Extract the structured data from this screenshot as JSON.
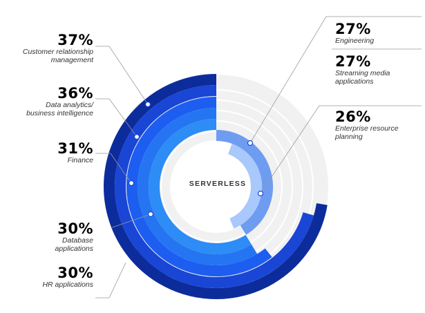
{
  "chart_data": {
    "type": "radial_bar",
    "center_label": "SERVERLESS",
    "series": [
      {
        "value": 37,
        "value_label": "37%",
        "label": "Customer relationship management",
        "lines": [
          "Customer relationship",
          "management"
        ],
        "color": "#0d2c9c",
        "text_color": "#0f3aa6",
        "side": "left"
      },
      {
        "value": 36,
        "value_label": "36%",
        "label": "Data analytics/ business intelligence",
        "lines": [
          "Data analytics/",
          "business intelligence"
        ],
        "color": "#1a46d6",
        "text_color": "#1a46d6",
        "side": "left"
      },
      {
        "value": 31,
        "value_label": "31%",
        "label": "Finance",
        "lines": [
          "Finance"
        ],
        "color": "#1d5ef0",
        "text_color": "#1d5ef0",
        "side": "left"
      },
      {
        "value": 30,
        "value_label": "30%",
        "label": "Database applications",
        "lines": [
          "Database",
          "applications"
        ],
        "color": "#2575f2",
        "text_color": "#5f7dd6",
        "side": "left"
      },
      {
        "value": 30,
        "value_label": "30%",
        "label": "HR applications",
        "lines": [
          "HR applications"
        ],
        "color": "#2d8cf5",
        "text_color": "#5f7dd6",
        "side": "left"
      },
      {
        "value": 27,
        "value_label": "27%",
        "label": "Engineering",
        "lines": [
          "Engineering"
        ],
        "color": "#6e9cf0",
        "text_color": "#5e8ef0",
        "side": "right"
      },
      {
        "value": 27,
        "value_label": "27%",
        "label": "Streaming media applications",
        "lines": [
          "Streaming media",
          "applications"
        ],
        "color": "#6e9cf0",
        "text_color": "#5e8ef0",
        "side": "right"
      },
      {
        "value": 26,
        "value_label": "26%",
        "label": "Enterprise resource planning",
        "lines": [
          "Enterprise resource",
          "planning"
        ],
        "color": "#a9c8fb",
        "text_color": "#8fb1f3",
        "side": "right"
      }
    ],
    "colors": {
      "track": "#f1f1f1",
      "grid": "#ffffff",
      "leader": "#999999"
    }
  }
}
